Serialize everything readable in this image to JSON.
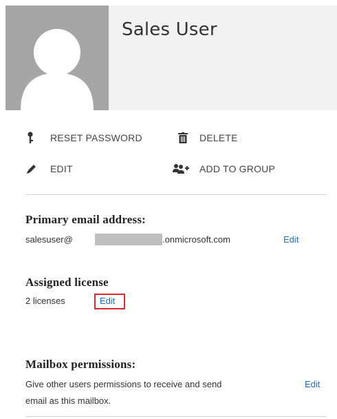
{
  "user": {
    "display_name": "Sales User"
  },
  "actions": {
    "reset_password": "RESET PASSWORD",
    "delete": "DELETE",
    "edit": "EDIT",
    "add_to_group": "ADD TO GROUP"
  },
  "email": {
    "title": "Primary email address:",
    "prefix": "salesuser@",
    "suffix": ".onmicrosoft.com",
    "edit_label": "Edit"
  },
  "license": {
    "title": "Assigned license",
    "count_text": "2 licenses",
    "edit_label": "Edit"
  },
  "mailbox": {
    "title": "Mailbox permissions:",
    "description_line1": "Give other users permissions to receive and send",
    "description_line2": "email as this mailbox.",
    "edit_label": "Edit"
  },
  "icons": {
    "reset_password": "key-icon",
    "delete": "trash-icon",
    "edit": "pencil-icon",
    "add_to_group": "add-group-icon",
    "avatar": "person-silhouette-icon"
  },
  "colors": {
    "link": "#1f6fbf",
    "highlight": "#e0282e",
    "avatar_bg": "#a6a6a6",
    "header_bg": "#f2f2f2"
  }
}
